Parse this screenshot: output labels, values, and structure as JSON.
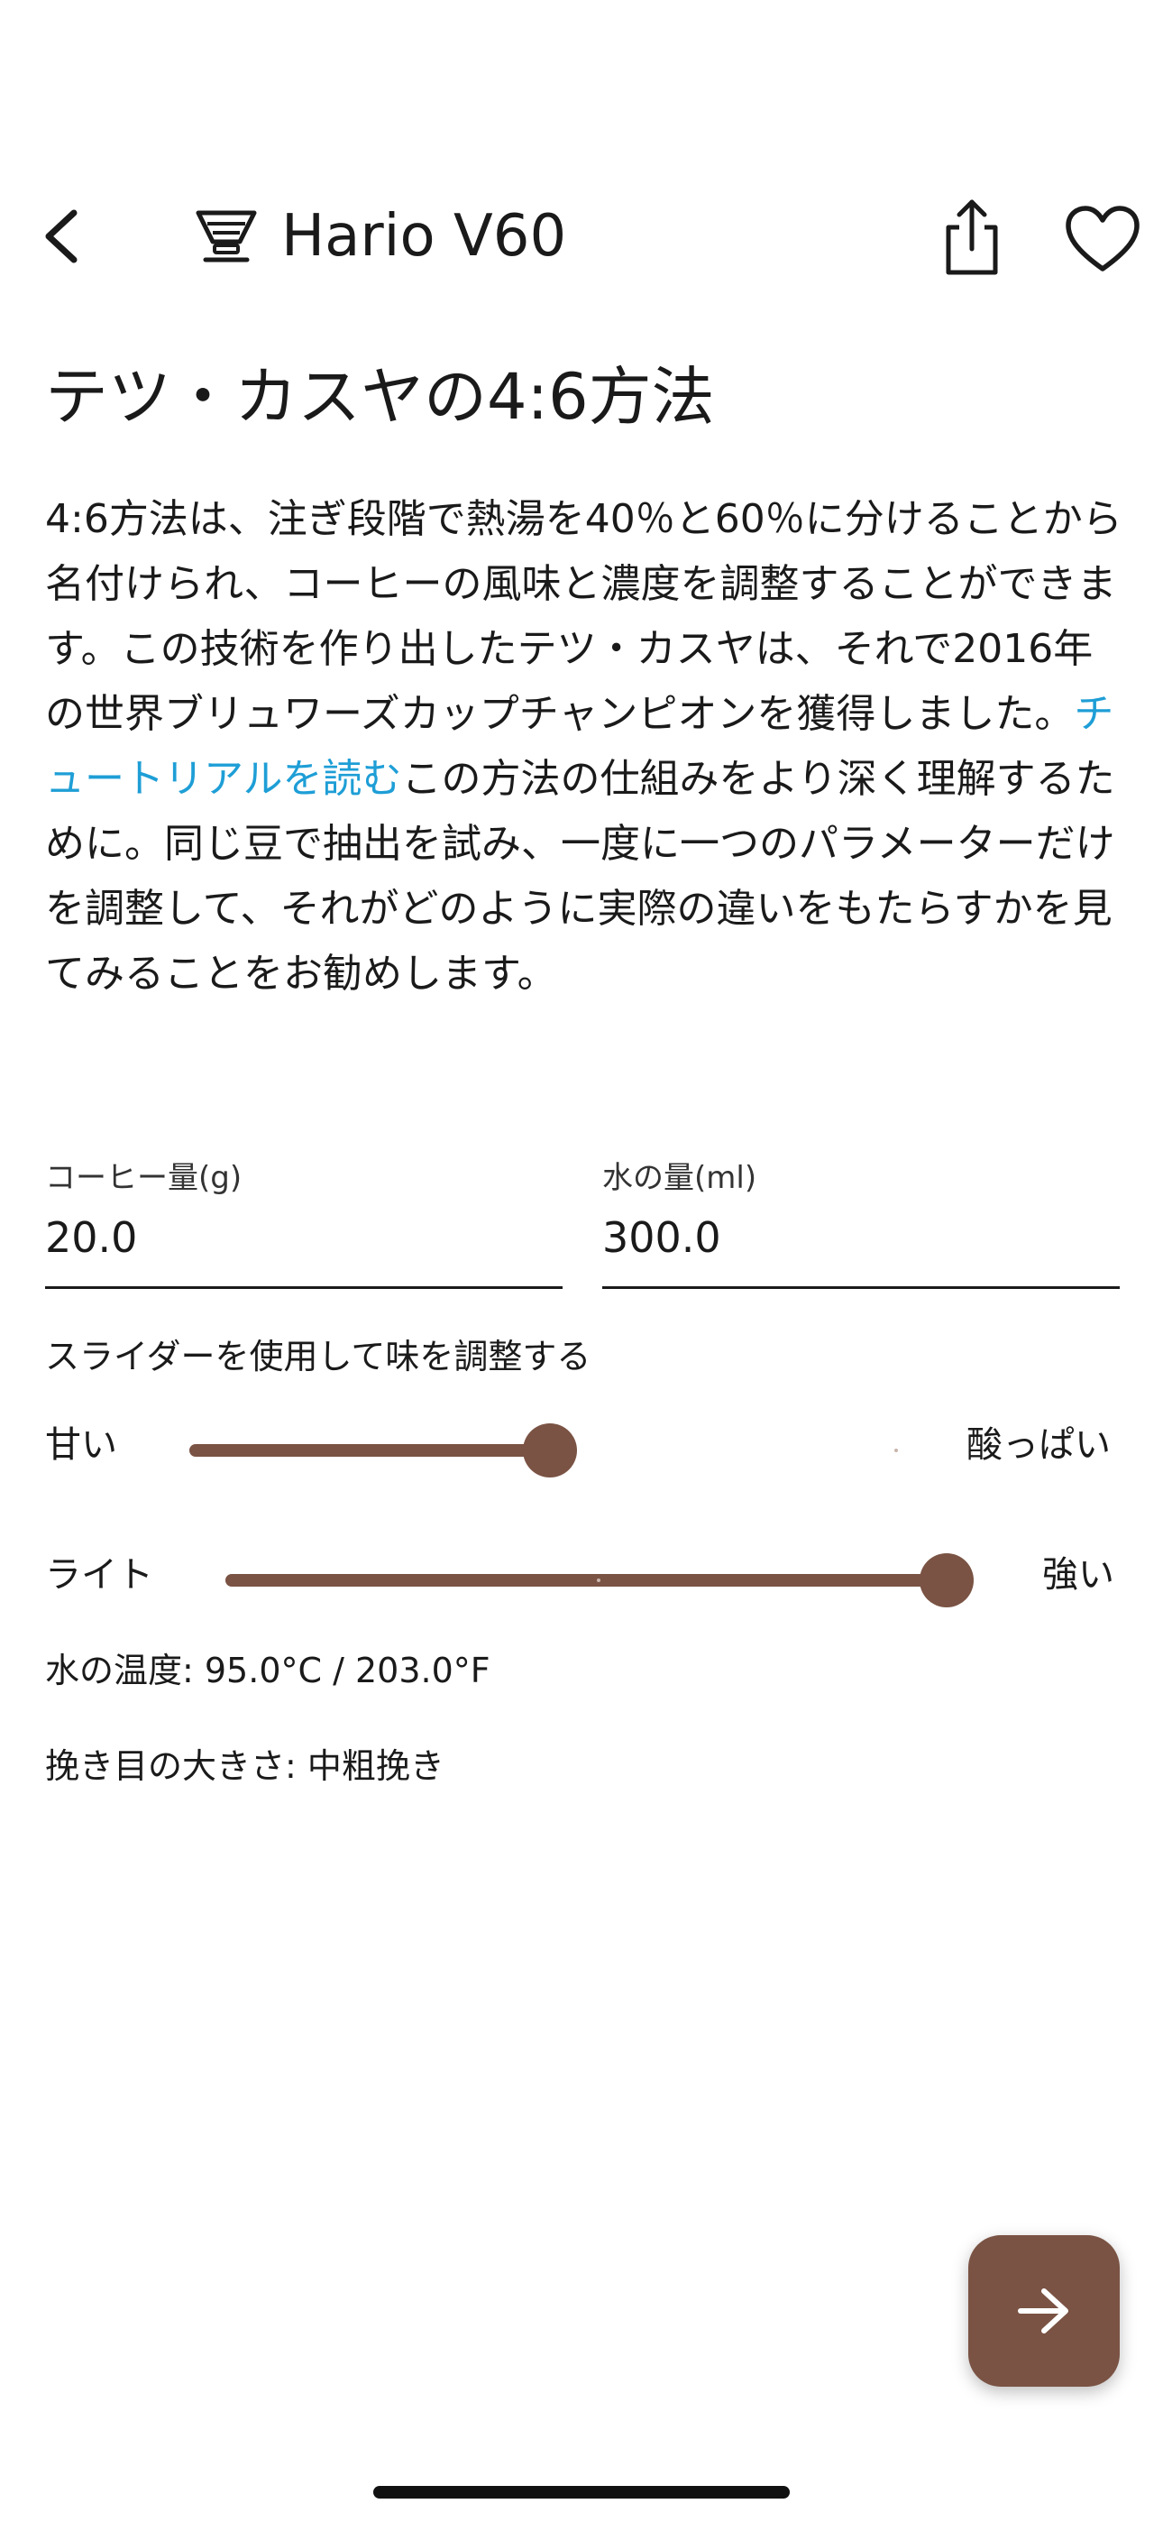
{
  "header": {
    "title": "Hario V60",
    "icons": {
      "back": "chevron-left-icon",
      "brewer": "dripper-icon",
      "share": "share-icon",
      "favorite": "heart-icon"
    }
  },
  "method": {
    "title": "テツ・カスヤの4:6方法",
    "description_before_link": "4:6方法は、注ぎ段階で熱湯を40％と60％に分けることから名付けられ、コーヒーの風味と濃度を調整することができます。この技術を作り出したテツ・カスヤは、それで2016年の世界ブリュワーズカップチャンピオンを獲得しました。",
    "tutorial_link": "チュートリアルを読む",
    "description_after_link": "この方法の仕組みをより深く理解するために。同じ豆で抽出を試み、一度に一つのパラメーターだけを調整して、それがどのように実際の違いをもたらすかを見てみることをお勧めします。"
  },
  "inputs": {
    "coffee": {
      "label": "コーヒー量(g)",
      "value": "20.0"
    },
    "water": {
      "label": "水の量(ml)",
      "value": "300.0"
    }
  },
  "sliders": {
    "caption": "スライダーを使用して味を調整する",
    "sweetness": {
      "left_label": "甘い",
      "right_label": "酸っぱい",
      "level": 0.5
    },
    "strength": {
      "left_label": "ライト",
      "right_label": "強い",
      "level": 1.0
    }
  },
  "info": {
    "water_temp": "水の温度: 95.0°C / 203.0°F",
    "grind_size": "挽き目の大きさ: 中粗挽き"
  },
  "colors": {
    "accent": "#7a5344",
    "link": "#1e9ed6"
  },
  "fab": {
    "icon": "arrow-right-icon"
  }
}
